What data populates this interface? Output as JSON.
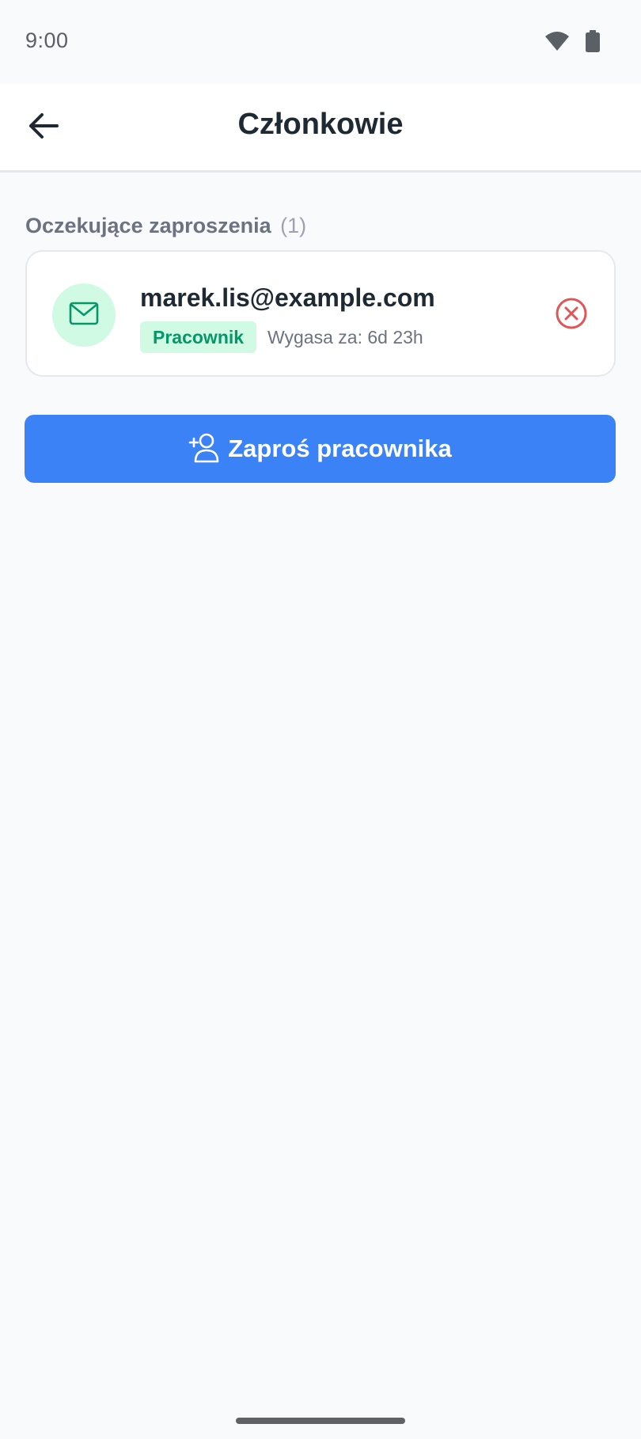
{
  "status_bar": {
    "time": "9:00",
    "icons": [
      "wifi-icon",
      "battery-icon"
    ]
  },
  "header": {
    "title": "Członkowie",
    "back_icon": "arrow-left-icon"
  },
  "pending_invites": {
    "heading": "Oczekujące zaproszenia",
    "count": "(1)",
    "items": [
      {
        "email": "marek.lis@example.com",
        "role": "Pracownik",
        "expires": "Wygasa za: 6d 23h",
        "icon": "mail-icon",
        "action_icon": "cancel-circle-icon"
      }
    ]
  },
  "invite_button": {
    "label": "Zaproś pracownika",
    "icon": "user-plus-icon"
  },
  "colors": {
    "primary": "#3b82f6",
    "badge_bg": "#d1fae5",
    "badge_text": "#059669",
    "danger": "#e05555",
    "background": "#f8fafc"
  }
}
